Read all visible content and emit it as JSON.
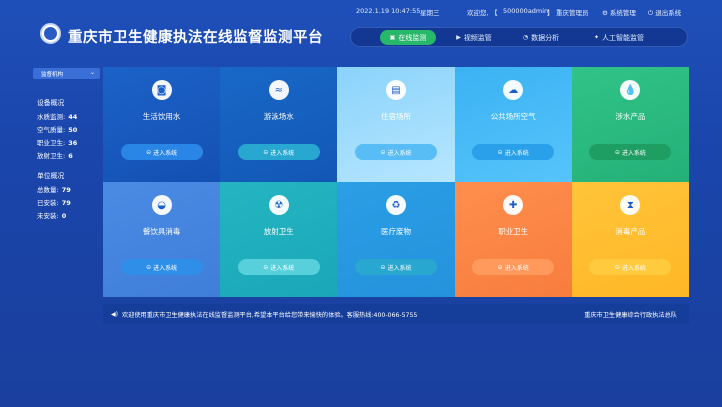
{
  "topbar": {
    "datetime": "2022.1.19 10:47:55",
    "weekday": "星期三",
    "welcome": "欢迎您,",
    "user_bracket_open": "【",
    "user": "500000admin",
    "user_bracket_close": "】",
    "role": "重庆管理员",
    "system_manage": "系统管理",
    "logout": "退出系统"
  },
  "app": {
    "title": "重庆市卫生健康执法在线监督监测平台"
  },
  "nav": [
    {
      "label": "在线监测",
      "icon": "▣",
      "active": true
    },
    {
      "label": "视频监管",
      "icon": "▶"
    },
    {
      "label": "数据分析",
      "icon": "◔"
    },
    {
      "label": "人工智能监管",
      "icon": "✦"
    }
  ],
  "sidebar": {
    "select": "监督机构",
    "device_title": "设备概况",
    "device_items": [
      {
        "label": "水质监测:",
        "value": "44"
      },
      {
        "label": "空气质量:",
        "value": "50"
      },
      {
        "label": "职业卫生:",
        "value": "36"
      },
      {
        "label": "放射卫生:",
        "value": "6"
      }
    ],
    "unit_title": "单位概况",
    "unit_items": [
      {
        "label": "总数量:",
        "value": "79"
      },
      {
        "label": "已安装:",
        "value": "79"
      },
      {
        "label": "未安装:",
        "value": "0"
      }
    ]
  },
  "cards": [
    {
      "label": "生活饮用水",
      "icon": "◙",
      "button": "进入系统"
    },
    {
      "label": "游泳场水",
      "icon": "≈",
      "button": "进入系统"
    },
    {
      "label": "住宿场所",
      "icon": "▤",
      "button": "进入系统"
    },
    {
      "label": "公共场所空气",
      "icon": "☁",
      "button": "进入系统"
    },
    {
      "label": "涉水产品",
      "icon": "💧",
      "button": "进入系统"
    },
    {
      "label": "餐饮具消毒",
      "icon": "◒",
      "button": "进入系统"
    },
    {
      "label": "放射卫生",
      "icon": "☢",
      "button": "进入系统"
    },
    {
      "label": "医疗废物",
      "icon": "♻",
      "button": "进入系统"
    },
    {
      "label": "职业卫生",
      "icon": "✚",
      "button": "进入系统"
    },
    {
      "label": "消毒产品",
      "icon": "⧗",
      "button": "进入系统"
    }
  ],
  "notice": {
    "text": "欢迎使用重庆市卫生健康执法在线监督监测平台,希望本平台给您带来愉快的体验。客服热线:400-066-5755",
    "right": "重庆市卫生健康综合行政执法总队"
  }
}
